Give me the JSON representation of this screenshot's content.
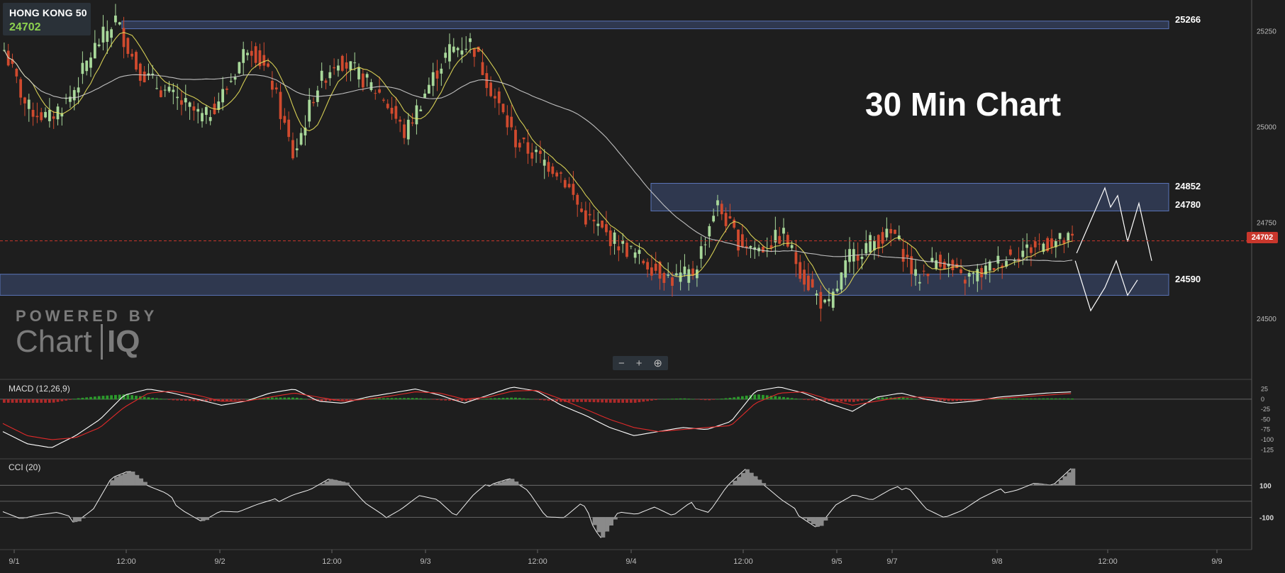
{
  "symbol": {
    "name": "HONG KONG 50",
    "price": "24702"
  },
  "title_overlay": "30 Min Chart",
  "watermark": {
    "powered": "POWERED BY",
    "chart": "Chart",
    "iq": "IQ"
  },
  "zoom": {
    "minus": "−",
    "plus": "+",
    "reset": "⊕"
  },
  "colors": {
    "background": "#1e1e1e",
    "up": "#a8d89a",
    "down": "#d04a2e",
    "zone": "#3a4a70",
    "ma_fast": "#e8e05a",
    "ma_slow": "#cfcfcf",
    "macd_line": "#ffffff",
    "signal_line": "#e02a2a",
    "current_price": "#c9372c"
  },
  "chart_data": [
    {
      "type": "candlestick",
      "title": "",
      "x_tick_labels": [
        "9/1",
        "12:00",
        "9/2",
        "12:00",
        "9/3",
        "12:00",
        "9/4",
        "12:00",
        "9/5",
        "9/7",
        "9/8",
        "12:00",
        "9/9"
      ],
      "y_ticks": [
        25250,
        25000,
        24750,
        24500
      ],
      "ylim": [
        24350,
        25330
      ],
      "current_price": 24702,
      "levels": [
        {
          "label": "25266",
          "value": 25266
        },
        {
          "label": "24852",
          "value": 24852
        },
        {
          "label": "24780",
          "value": 24780
        },
        {
          "label": "24590",
          "value": 24590
        }
      ],
      "zones": [
        [
          25255,
          25275
        ],
        [
          24780,
          24852
        ],
        [
          24560,
          24615
        ]
      ],
      "anchor_closes": [
        25200,
        25050,
        25020,
        25080,
        25200,
        25280,
        25150,
        25100,
        25060,
        25020,
        25100,
        25220,
        25120,
        24920,
        25100,
        25180,
        25130,
        25080,
        24980,
        25100,
        25200,
        25220,
        25080,
        24960,
        24920,
        24880,
        24770,
        24720,
        24680,
        24640,
        24600,
        24620,
        24800,
        24700,
        24680,
        24720,
        24600,
        24520,
        24660,
        24700,
        24720,
        24600,
        24660,
        24600,
        24620,
        24660,
        24680,
        24700,
        24702
      ],
      "projection": [
        24670,
        24840,
        24790,
        24820,
        24700,
        24650,
        24520,
        24580,
        24650
      ],
      "projection_low": [
        24640,
        24540,
        24600,
        24680
      ]
    },
    {
      "type": "line",
      "title": "MACD (12,26,9)",
      "y_ticks": [
        25,
        0,
        -25,
        -50,
        -75,
        -100,
        -125
      ],
      "ylim": [
        -135,
        40
      ],
      "macd_anchor": [
        -80,
        -110,
        -120,
        -90,
        -50,
        10,
        25,
        15,
        0,
        -15,
        -5,
        15,
        25,
        -5,
        -10,
        5,
        15,
        25,
        10,
        -10,
        10,
        30,
        20,
        -15,
        -40,
        -70,
        -90,
        -80,
        -70,
        -75,
        -55,
        20,
        30,
        15,
        -10,
        -30,
        5,
        15,
        0,
        -10,
        -5,
        5,
        10,
        15,
        18
      ],
      "signal_anchor": [
        -60,
        -90,
        -100,
        -95,
        -70,
        -20,
        15,
        20,
        10,
        -5,
        -5,
        5,
        15,
        5,
        -5,
        0,
        8,
        18,
        15,
        0,
        5,
        20,
        22,
        0,
        -25,
        -50,
        -70,
        -80,
        -75,
        -70,
        -65,
        -10,
        15,
        18,
        0,
        -15,
        -5,
        5,
        5,
        0,
        -2,
        2,
        6,
        10,
        14
      ]
    },
    {
      "type": "line",
      "title": "CCI (20)",
      "y_ticks": [
        100,
        -100
      ],
      "ylim": [
        -280,
        230
      ],
      "cci_anchor": [
        -60,
        -110,
        -90,
        -80,
        -120,
        -40,
        150,
        190,
        90,
        40,
        -50,
        -120,
        -60,
        -70,
        -30,
        0,
        50,
        80,
        140,
        110,
        -20,
        -100,
        -40,
        40,
        10,
        -100,
        30,
        120,
        150,
        70,
        -100,
        -110,
        -20,
        -220,
        -60,
        -80,
        -40,
        -100,
        -20,
        -60,
        100,
        200,
        100,
        0,
        -80,
        -160,
        -20,
        40,
        0,
        60,
        100,
        -40,
        -100,
        -60,
        10,
        60,
        80,
        120,
        100,
        200
      ]
    }
  ]
}
